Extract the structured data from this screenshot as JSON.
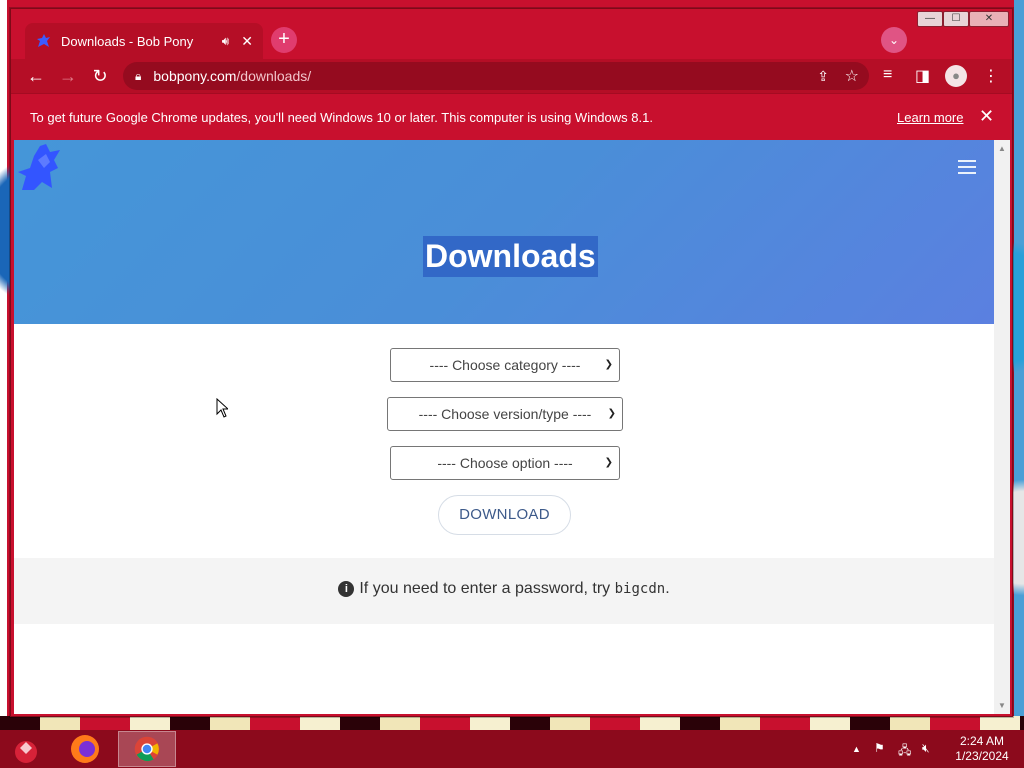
{
  "browser": {
    "tab": {
      "title": "Downloads - Bob Pony"
    },
    "url": {
      "host": "bobpony.com",
      "path": "/downloads/"
    },
    "window_controls": {
      "minimize": "—",
      "maximize": "☐",
      "close": "✕"
    }
  },
  "infobar": {
    "message": "To get future Google Chrome updates, you'll need Windows 10 or later. This computer is using Windows 8.1.",
    "learn_more": "Learn more"
  },
  "page": {
    "title": "Downloads",
    "selects": {
      "category": "---- Choose category ----",
      "version": "---- Choose version/type ----",
      "option": "---- Choose option ----"
    },
    "download_button": "DOWNLOAD",
    "note": {
      "prefix": "If you need to enter a password, try ",
      "password": "bigcdn",
      "suffix": "."
    }
  },
  "taskbar": {
    "clock_time": "2:24 AM",
    "clock_date": "1/23/2024"
  },
  "colors": {
    "chrome_theme": "#c8102e",
    "hero_blue": "#4a8ed8",
    "title_highlight": "#3268c7"
  },
  "icons": [
    "bobpony-favicon",
    "audio-icon",
    "close-icon",
    "new-tab-icon",
    "tab-search-icon",
    "back-icon",
    "forward-icon",
    "reload-icon",
    "lock-icon",
    "share-icon",
    "star-icon",
    "media-icon",
    "sidepanel-icon",
    "profile-icon",
    "menu-icon",
    "hamburger-icon",
    "info-icon",
    "firefox-icon",
    "chrome-icon"
  ]
}
